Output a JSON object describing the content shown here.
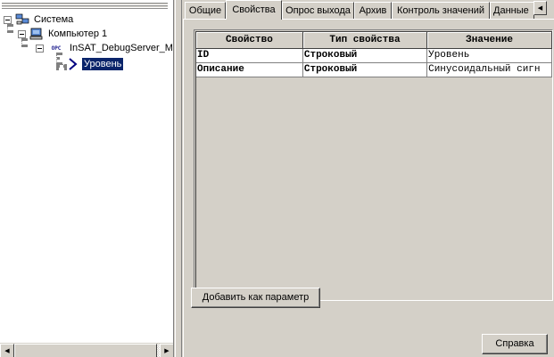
{
  "tree": {
    "items": [
      {
        "label": "Система",
        "icon": "network-icon"
      },
      {
        "label": "Компьютер 1",
        "icon": "computer-icon"
      },
      {
        "label": "InSAT_DebugServer_M",
        "icon": "opc-server-icon",
        "icon_text": "OPC"
      },
      {
        "label": "Уровень",
        "icon": "tag-arrow-icon",
        "selected": true
      }
    ]
  },
  "tabs": [
    {
      "label": "Общие"
    },
    {
      "label": "Свойства",
      "active": true
    },
    {
      "label": "Опрос выхода"
    },
    {
      "label": "Архив"
    },
    {
      "label": "Контроль значений"
    },
    {
      "label": "Данные"
    }
  ],
  "grid": {
    "columns": [
      "Свойство",
      "Тип свойства",
      "Значение"
    ],
    "rows": [
      [
        "ID",
        "Строковый",
        "Уровень"
      ],
      [
        "Описание",
        "Строковый",
        "Синусоидальный сигн"
      ]
    ]
  },
  "buttons": {
    "add_as_param": "Добавить как параметр",
    "help": "Справка"
  },
  "colors": {
    "selection": "#0a246a",
    "face": "#d4d0c8"
  }
}
